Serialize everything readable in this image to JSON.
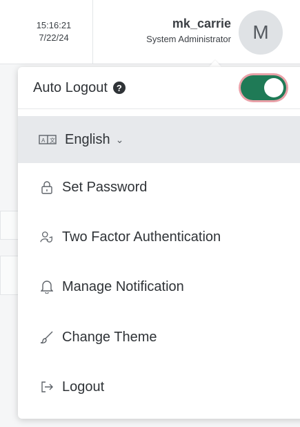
{
  "header": {
    "time": "15:16:21",
    "date": "7/22/24",
    "username": "mk_carrie",
    "role": "System Administrator",
    "avatar_letter": "M"
  },
  "menu": {
    "auto_logout_label": "Auto Logout",
    "help_symbol": "?",
    "auto_logout_enabled": true,
    "language_label": "English",
    "items": [
      {
        "label": "Set Password",
        "icon": "lock-icon"
      },
      {
        "label": "Two Factor Authentication",
        "icon": "user-shield-icon"
      },
      {
        "label": "Manage Notification",
        "icon": "bell-icon"
      },
      {
        "label": "Change Theme",
        "icon": "brush-icon"
      },
      {
        "label": "Logout",
        "icon": "logout-icon"
      }
    ]
  },
  "colors": {
    "toggle_on": "#1f7a56",
    "toggle_ring": "#e9a1a8",
    "selected_row": "#e7e9ec"
  }
}
